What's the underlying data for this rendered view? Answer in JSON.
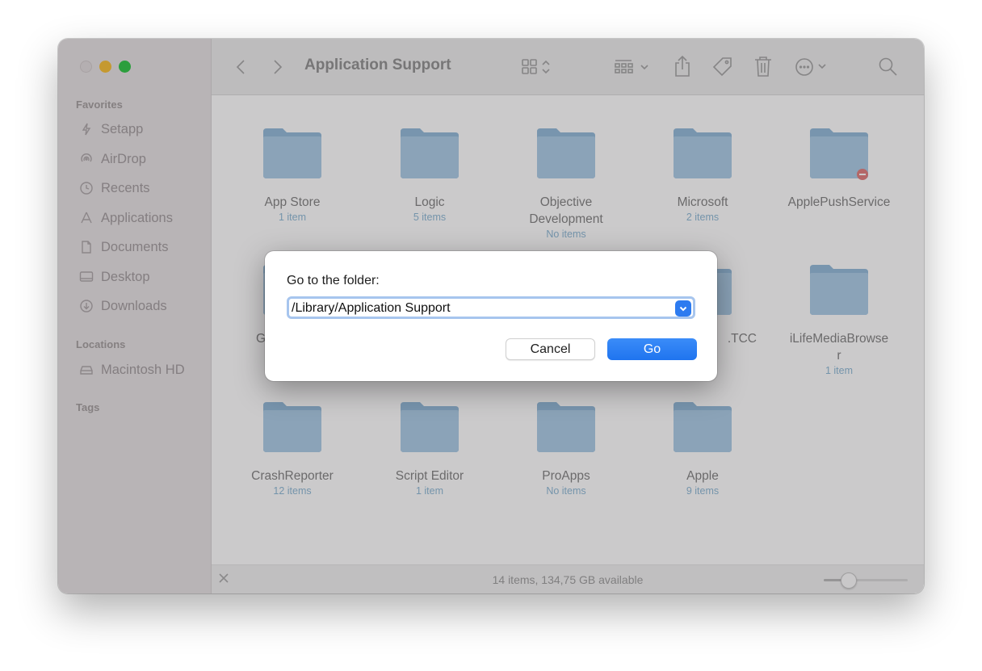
{
  "window": {
    "title": "Application Support"
  },
  "sidebar": {
    "favorites_label": "Favorites",
    "favorites": [
      {
        "label": "Setapp",
        "icon": "setapp-icon"
      },
      {
        "label": "AirDrop",
        "icon": "airdrop-icon"
      },
      {
        "label": "Recents",
        "icon": "clock-icon"
      },
      {
        "label": "Applications",
        "icon": "applications-icon"
      },
      {
        "label": "Documents",
        "icon": "document-icon"
      },
      {
        "label": "Desktop",
        "icon": "desktop-icon"
      },
      {
        "label": "Downloads",
        "icon": "download-icon"
      }
    ],
    "locations_label": "Locations",
    "locations": [
      {
        "label": "Macintosh HD",
        "icon": "hard-drive-icon"
      }
    ],
    "tags_label": "Tags"
  },
  "folders": [
    {
      "name": "App Store",
      "count": "1 item"
    },
    {
      "name": "Logic",
      "count": "5 items"
    },
    {
      "name": "Objective\nDevelopment",
      "count": "No items"
    },
    {
      "name": "Microsoft",
      "count": "2 items"
    },
    {
      "name": "ApplePushService",
      "count": "",
      "badge": "no-access-icon"
    },
    {
      "name": "G",
      "count": ""
    },
    {
      "name": "",
      "count": ""
    },
    {
      "name": "",
      "count": ""
    },
    {
      "name": ".TCC",
      "count": ""
    },
    {
      "name": "iLifeMediaBrowse\nr",
      "count": "1 item"
    },
    {
      "name": "CrashReporter",
      "count": "12 items"
    },
    {
      "name": "Script Editor",
      "count": "1 item"
    },
    {
      "name": "ProApps",
      "count": "No items"
    },
    {
      "name": "Apple",
      "count": "9 items"
    }
  ],
  "status": {
    "text": "14 items, 134,75 GB available",
    "icon_size": 0.25
  },
  "dialog": {
    "label": "Go to the folder:",
    "path_value": "/Library/Application Support",
    "cancel_label": "Cancel",
    "go_label": "Go"
  },
  "colors": {
    "accent": "#2d7bf0",
    "folder": "#9ec3e0",
    "traffic_minimize": "#f7bd2f",
    "traffic_maximize": "#29c440"
  }
}
